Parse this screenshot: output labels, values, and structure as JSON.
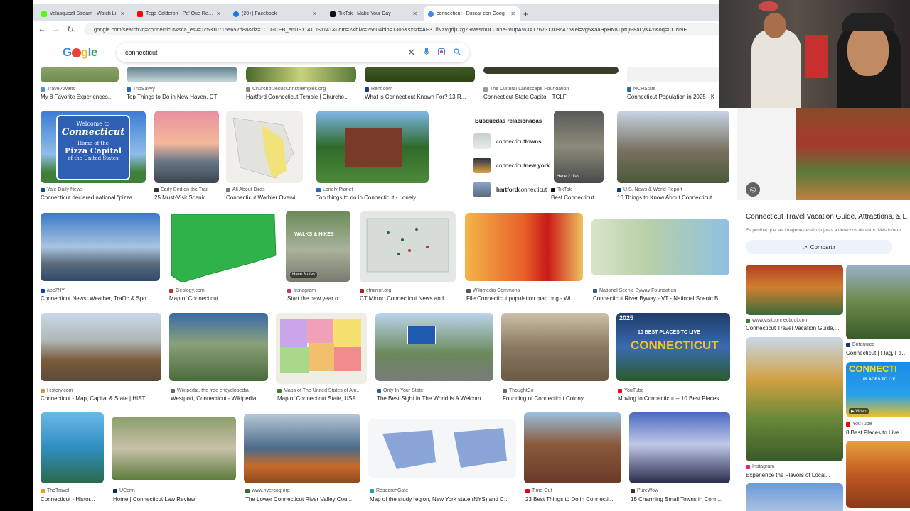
{
  "tabs": [
    {
      "title": "Velasquezll Stream - Watch Li",
      "color": "#53fc18"
    },
    {
      "title": "Tego Calderon - Pa' Que Retoze",
      "color": "#ff0000"
    },
    {
      "title": "(20+) Facebook",
      "color": "#1877f2"
    },
    {
      "title": "TikTok - Make Your Day",
      "color": "#111111"
    },
    {
      "title": "connecticut - Buscar con Googl",
      "color": "#4285f4"
    }
  ],
  "address_bar": {
    "url": "google.com/search?q=connecticut&sca_esv=1c5310715e652d88&rlz=1C1GCEB_enUS1141US1141&udm=2&biw=2560&bih=1305&sxsrf=AE3TifNzVgdjl0zgZ9MesmDOJnhe-IvDpA%3A1767313086475&ei=vg5XaaHpHNKLptQP8aLyKAY&oq=CONNE"
  },
  "search": {
    "query": "connecticut"
  },
  "related": {
    "heading": "Búsquedas relacionadas",
    "items": [
      {
        "prefix": "connecticut ",
        "bold": "towns",
        "post": ""
      },
      {
        "prefix": "connecticut ",
        "bold": "new york",
        "post": ""
      },
      {
        "prefix": "",
        "bold": "hartford",
        "post": " connecticut"
      }
    ]
  },
  "results": [
    {
      "source": "TravelAwaits",
      "title": "My 8 Favorite Experiences..."
    },
    {
      "source": "TripSavvy",
      "title": "Top Things to Do in New Haven, CT"
    },
    {
      "source": "ChurchofJesusChristTemples.org",
      "title": "Hartford Connecticut Temple | Churcho..."
    },
    {
      "source": "Rent.com",
      "title": "What is Connecticut Known For? 13 R..."
    },
    {
      "source": "The Cultural Landscape Foundation",
      "title": "Connecticut State Capitol | TCLF"
    },
    {
      "source": "NCHStats",
      "title": "Connecticut Population in 2025 - K"
    },
    {
      "source": "Yale Daily News",
      "title": "Connecticut declared national \"pizza ..."
    },
    {
      "source": "Early Bird on the Trail",
      "title": "25 Must-Visit Scenic ..."
    },
    {
      "source": "All About Birds",
      "title": "Connecticut Warbler Overvi..."
    },
    {
      "source": "Lonely Planet",
      "title": "Top things to do in Connecticut - Lonely ..."
    },
    {
      "source": "TikTok",
      "title": "Best Connecticut ..."
    },
    {
      "source": "U.S. News & World Report",
      "title": "10 Things to Know About Connecticut"
    },
    {
      "source": "abc7NY",
      "title": "Connecticut News, Weather, Traffic & Spo..."
    },
    {
      "source": "Geology.com",
      "title": "Map of Connecticut"
    },
    {
      "source": "Instagram",
      "title": "Start the new year o..."
    },
    {
      "source": "ctmirror.org",
      "title": "CT Mirror: Connecticut News and ..."
    },
    {
      "source": "Wikimedia Commons",
      "title": "File:Connecticut population map.png - Wi..."
    },
    {
      "source": "National Scenic Byway Foundation",
      "title": "Connecticut River Byway - VT - National Scenic B..."
    },
    {
      "source": "History.com",
      "title": "Connecticut - Map, Capital & State | HIST..."
    },
    {
      "source": "Wikipedia, the free encyclopedia",
      "title": "Westport, Connecticut - Wikipedia"
    },
    {
      "source": "Maps of The United States of Am...",
      "title": "Map of Connecticut State, USA..."
    },
    {
      "source": "Only In Your State",
      "title": "The Best Sight In The World Is A Welcom..."
    },
    {
      "source": "ThoughtCo",
      "title": "Founding of Connecticut Colony"
    },
    {
      "source": "YouTube",
      "title": "Moving to Connecticut -- 10 Best Places..."
    },
    {
      "source": "TheTravel",
      "title": "Connecticut - Histor..."
    },
    {
      "source": "UConn",
      "title": "Home | Connecticut Law Review"
    },
    {
      "source": "www.rivercog.org",
      "title": "The Lower Connecticut River Valley Cou..."
    },
    {
      "source": "ResearchGate",
      "title": "Map of the study region, New York state (NYS) and C..."
    },
    {
      "source": "Time Out",
      "title": "23 Best Things to Do in Connecti..."
    },
    {
      "source": "PureWow",
      "title": "15 Charming Small Towns in Conn..."
    }
  ],
  "overlay_text": {
    "welcome_sign": [
      "Welcome to",
      "Connecticut",
      "Home of the",
      "Pizza Capital",
      "of the United States"
    ],
    "tiktok_badge": "Hace 2 días",
    "walks_title": "WALKS & HIKES",
    "walks_badge": "Hace 3 días",
    "video_top": "2025",
    "video_sub": "10 BEST PLACES TO LIVE",
    "video_big": "CONNECTICUT",
    "side_video_big": "CONNECTI",
    "side_video_sub": "PLACES TO LIV",
    "side_video_badge": "Video"
  },
  "side_panel": {
    "title": "Connecticut Travel Vacation Guide, Attractions, & E",
    "note": "Es posible que las imágenes estén sujetas a derechos de autor. Más inform",
    "share_label": "Compartir",
    "items": [
      {
        "source": "www.visitconnecticut.com",
        "title": "Connecticut Travel Vacation Guide,..."
      },
      {
        "source": "Britannica",
        "title": "Connecticut | Flag, Facts, H"
      },
      {
        "source": "YouTube",
        "title": "8 Best Places to Live in Con"
      },
      {
        "source": "Instagram",
        "title": "Experience the Flavors of Local..."
      }
    ]
  }
}
